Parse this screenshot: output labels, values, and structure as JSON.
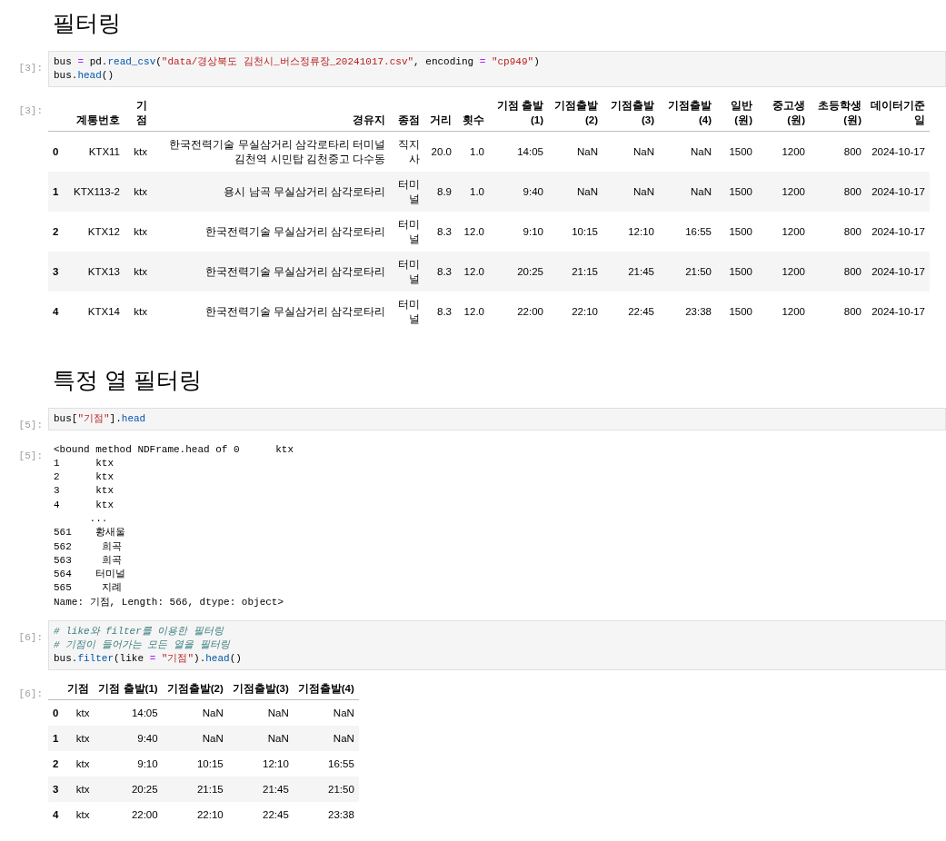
{
  "cells": [
    {
      "kind": "heading",
      "text": "필터링"
    },
    {
      "kind": "code",
      "prompt": "[3]:",
      "lines": [
        [
          {
            "kind": "plain",
            "s": "bus"
          },
          {
            "kind": "op",
            "s": " = "
          },
          {
            "kind": "plain",
            "s": "pd."
          },
          {
            "kind": "attr",
            "s": "read_csv"
          },
          {
            "kind": "plain",
            "s": "("
          },
          {
            "kind": "string",
            "s": "\"data/경상북도 김천시_버스정류장_20241017.csv\""
          },
          {
            "kind": "plain",
            "s": ", encoding"
          },
          {
            "kind": "op",
            "s": " = "
          },
          {
            "kind": "string",
            "s": "\"cp949\""
          },
          {
            "kind": "plain",
            "s": ")"
          }
        ],
        [
          {
            "kind": "plain",
            "s": "bus."
          },
          {
            "kind": "attr",
            "s": "head"
          },
          {
            "kind": "plain",
            "s": "()"
          }
        ]
      ]
    },
    {
      "kind": "table",
      "prompt": "[3]:",
      "columns": [
        "계통번호",
        "기점",
        "경유지",
        "종점",
        "거리",
        "횟수",
        "기점 출발(1)",
        "기점출발(2)",
        "기점출발(3)",
        "기점출발(4)",
        "일반(원)",
        "중고생(원)",
        "초등학생(원)",
        "데이터기준일"
      ],
      "rows": [
        {
          "index": "0",
          "cells": [
            "KTX11",
            "ktx",
            "한국전력기술 무실삼거리 삼각로타리 터미널 김천역 시민탑 김천중고 다수동",
            "직지사",
            "20.0",
            "1.0",
            "14:05",
            "NaN",
            "NaN",
            "NaN",
            "1500",
            "1200",
            "800",
            "2024-10-17"
          ]
        },
        {
          "index": "1",
          "cells": [
            "KTX113-2",
            "ktx",
            "용시 남곡 무실삼거리 삼각로타리",
            "터미널",
            "8.9",
            "1.0",
            "9:40",
            "NaN",
            "NaN",
            "NaN",
            "1500",
            "1200",
            "800",
            "2024-10-17"
          ]
        },
        {
          "index": "2",
          "cells": [
            "KTX12",
            "ktx",
            "한국전력기술 무실삼거리 삼각로타리",
            "터미널",
            "8.3",
            "12.0",
            "9:10",
            "10:15",
            "12:10",
            "16:55",
            "1500",
            "1200",
            "800",
            "2024-10-17"
          ]
        },
        {
          "index": "3",
          "cells": [
            "KTX13",
            "ktx",
            "한국전력기술 무실삼거리 삼각로타리",
            "터미널",
            "8.3",
            "12.0",
            "20:25",
            "21:15",
            "21:45",
            "21:50",
            "1500",
            "1200",
            "800",
            "2024-10-17"
          ]
        },
        {
          "index": "4",
          "cells": [
            "KTX14",
            "ktx",
            "한국전력기술 무실삼거리 삼각로타리",
            "터미널",
            "8.3",
            "12.0",
            "22:00",
            "22:10",
            "22:45",
            "23:38",
            "1500",
            "1200",
            "800",
            "2024-10-17"
          ]
        }
      ]
    },
    {
      "kind": "heading",
      "text": "특정 열 필터링"
    },
    {
      "kind": "code",
      "prompt": "[5]:",
      "lines": [
        [
          {
            "kind": "plain",
            "s": "bus["
          },
          {
            "kind": "string",
            "s": "\"기점\""
          },
          {
            "kind": "plain",
            "s": "]."
          },
          {
            "kind": "attr",
            "s": "head"
          }
        ]
      ]
    },
    {
      "kind": "text",
      "prompt": "[5]:",
      "lines": [
        "<bound method NDFrame.head of 0      ktx",
        "1      ktx",
        "2      ktx",
        "3      ktx",
        "4      ktx",
        "      ...",
        "561    황새울",
        "562     희곡",
        "563     희곡",
        "564    터미널",
        "565     지례",
        "Name: 기점, Length: 566, dtype: object>"
      ]
    },
    {
      "kind": "code",
      "prompt": "[6]:",
      "lines": [
        [
          {
            "kind": "comment",
            "s": "# like와 filter를 이용한 필터링"
          }
        ],
        [
          {
            "kind": "comment",
            "s": "# 기점이 들어가는 모든 열을 필터링"
          }
        ],
        [
          {
            "kind": "plain",
            "s": "bus."
          },
          {
            "kind": "attr",
            "s": "filter"
          },
          {
            "kind": "plain",
            "s": "(like"
          },
          {
            "kind": "op",
            "s": " = "
          },
          {
            "kind": "string",
            "s": "\"기점\""
          },
          {
            "kind": "plain",
            "s": ")."
          },
          {
            "kind": "attr",
            "s": "head"
          },
          {
            "kind": "plain",
            "s": "()"
          }
        ]
      ]
    },
    {
      "kind": "table",
      "prompt": "[6]:",
      "columns": [
        "기점",
        "기점 출발(1)",
        "기점출발(2)",
        "기점출발(3)",
        "기점출발(4)"
      ],
      "rows": [
        {
          "index": "0",
          "cells": [
            "ktx",
            "14:05",
            "NaN",
            "NaN",
            "NaN"
          ]
        },
        {
          "index": "1",
          "cells": [
            "ktx",
            "9:40",
            "NaN",
            "NaN",
            "NaN"
          ]
        },
        {
          "index": "2",
          "cells": [
            "ktx",
            "9:10",
            "10:15",
            "12:10",
            "16:55"
          ]
        },
        {
          "index": "3",
          "cells": [
            "ktx",
            "20:25",
            "21:15",
            "21:45",
            "21:50"
          ]
        },
        {
          "index": "4",
          "cells": [
            "ktx",
            "22:00",
            "22:10",
            "22:45",
            "23:38"
          ]
        }
      ]
    }
  ]
}
